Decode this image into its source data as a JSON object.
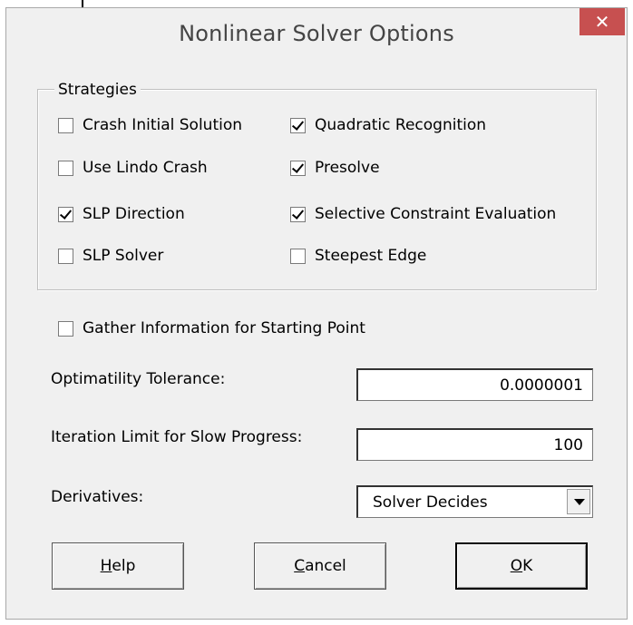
{
  "window": {
    "title": "Nonlinear Solver Options",
    "close_glyph": "✕"
  },
  "strategies": {
    "legend": "Strategies",
    "left": [
      {
        "label": "Crash Initial Solution",
        "checked": false
      },
      {
        "label": "Use Lindo Crash",
        "checked": false
      },
      {
        "label": "SLP Direction",
        "checked": true
      },
      {
        "label": "SLP Solver",
        "checked": false
      }
    ],
    "right": [
      {
        "label": "Quadratic Recognition",
        "checked": true
      },
      {
        "label": "Presolve",
        "checked": true
      },
      {
        "label": "Selective Constraint Evaluation",
        "checked": true
      },
      {
        "label": "Steepest Edge",
        "checked": false
      }
    ]
  },
  "gather": {
    "label": "Gather Information for Starting Point",
    "checked": false
  },
  "fields": {
    "optimality_label": "Optimatility Tolerance:",
    "optimality_value": "0.0000001",
    "iteration_label": "Iteration Limit for Slow Progress:",
    "iteration_value": "100",
    "derivatives_label": "Derivatives:",
    "derivatives_value": "Solver Decides"
  },
  "buttons": {
    "help_hotkey": "H",
    "help_rest": "elp",
    "cancel_hotkey": "C",
    "cancel_rest": "ancel",
    "ok_hotkey": "O",
    "ok_rest": "K"
  },
  "icons": {
    "close": "close-icon",
    "dropdown": "chevron-down-icon",
    "check": "checkmark-icon"
  },
  "colors": {
    "close_button": "#c75050",
    "dialog_bg": "#f0f0f0"
  }
}
